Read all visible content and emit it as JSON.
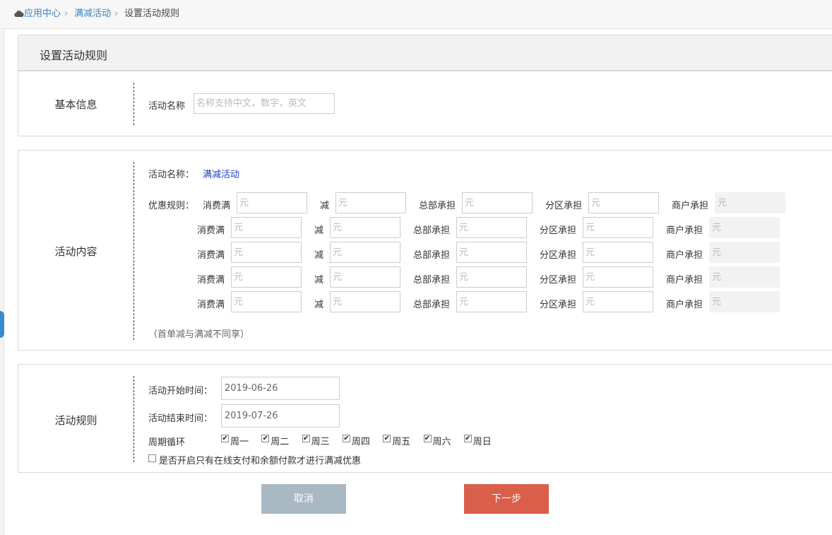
{
  "breadcrumb": {
    "items": [
      "应用中心",
      "满减活动",
      "设置活动规则"
    ],
    "separator": "›"
  },
  "title": "设置活动规则",
  "basic": {
    "heading": "基本信息",
    "name_label": "活动名称",
    "name_placeholder": "名称支持中文，数字，英文"
  },
  "content": {
    "heading": "活动内容",
    "name_label": "活动名称：",
    "name_value": "满减活动",
    "rules_label": "优惠规则：",
    "spend_label": "消费满",
    "minus_label": "减",
    "hq_label": "总部承担",
    "branch_label": "分区承担",
    "merchant_label": "商户承担",
    "unit_placeholder": "元",
    "rows": 5,
    "note": "（首单减与满减不同享）"
  },
  "rules": {
    "heading": "活动规则",
    "start_label": "活动开始时间：",
    "start_value": "2019-06-26",
    "end_label": "活动结束时间：",
    "end_value": "2019-07-26",
    "cycle_label": "周期循环",
    "days": [
      "周一",
      "周二",
      "周三",
      "周四",
      "周五",
      "周六",
      "周日"
    ],
    "online_only_label": "是否开启只有在线支付和余额付款才进行满减优惠"
  },
  "buttons": {
    "cancel": "取消",
    "next": "下一步"
  },
  "colors": {
    "link": "#3a82bf",
    "cancel_button": "#a9b9c4",
    "next_button": "#d95f4a"
  }
}
